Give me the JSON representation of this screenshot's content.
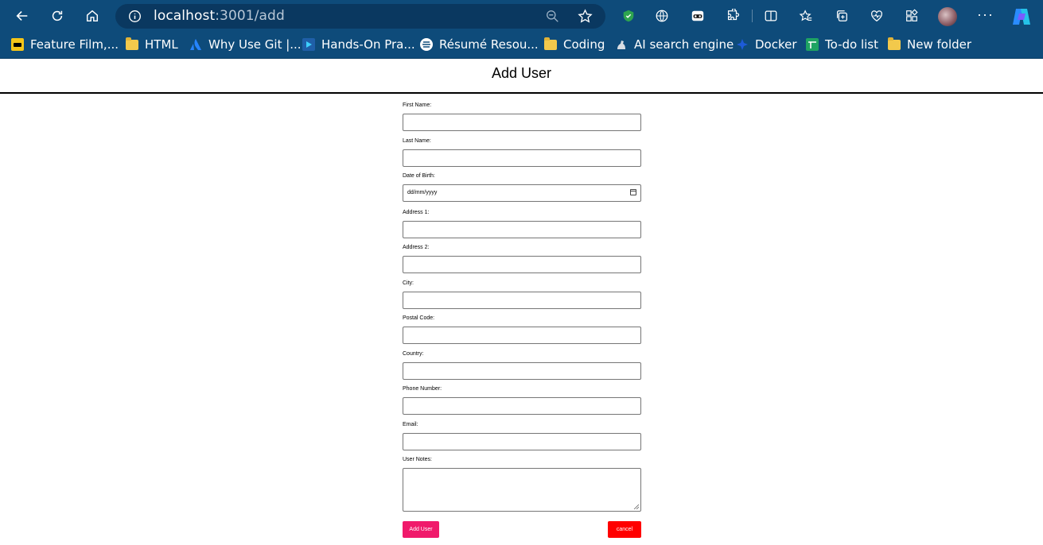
{
  "browser": {
    "url_host": "localhost",
    "url_path": ":3001/add",
    "accent": "#0e4b7a"
  },
  "bookmarks": [
    {
      "label": "Feature Film,...",
      "icon": "imdb-icon"
    },
    {
      "label": "HTML",
      "icon": "folder-icon"
    },
    {
      "label": "Why Use Git |...",
      "icon": "atlassian-icon"
    },
    {
      "label": "Hands-On Pra...",
      "icon": "video-icon"
    },
    {
      "label": "Résumé Resou...",
      "icon": "globe-icon"
    },
    {
      "label": "Coding",
      "icon": "folder-icon"
    },
    {
      "label": "AI search engine",
      "icon": "ai-icon"
    },
    {
      "label": "Docker",
      "icon": "docker-icon"
    },
    {
      "label": "To-do list",
      "icon": "sheets-icon"
    },
    {
      "label": "New folder",
      "icon": "folder-icon"
    }
  ],
  "page": {
    "title": "Add User"
  },
  "form": {
    "fields": [
      {
        "label": "First Name:",
        "value": ""
      },
      {
        "label": "Last Name:",
        "value": ""
      },
      {
        "label": "Date of Birth:",
        "placeholder": "dd/mm/yyyy"
      },
      {
        "label": "Address 1:",
        "value": ""
      },
      {
        "label": "Address 2:",
        "value": ""
      },
      {
        "label": "City:",
        "value": ""
      },
      {
        "label": "Postal Code:",
        "value": ""
      },
      {
        "label": "Country:",
        "value": ""
      },
      {
        "label": "Phone Number:",
        "value": ""
      },
      {
        "label": "Email:",
        "value": ""
      },
      {
        "label": "User Notes:",
        "value": ""
      }
    ],
    "submit_label": "Add User",
    "cancel_label": "cancel",
    "submit_color": "#f01a6b",
    "cancel_color": "#ff0000"
  }
}
